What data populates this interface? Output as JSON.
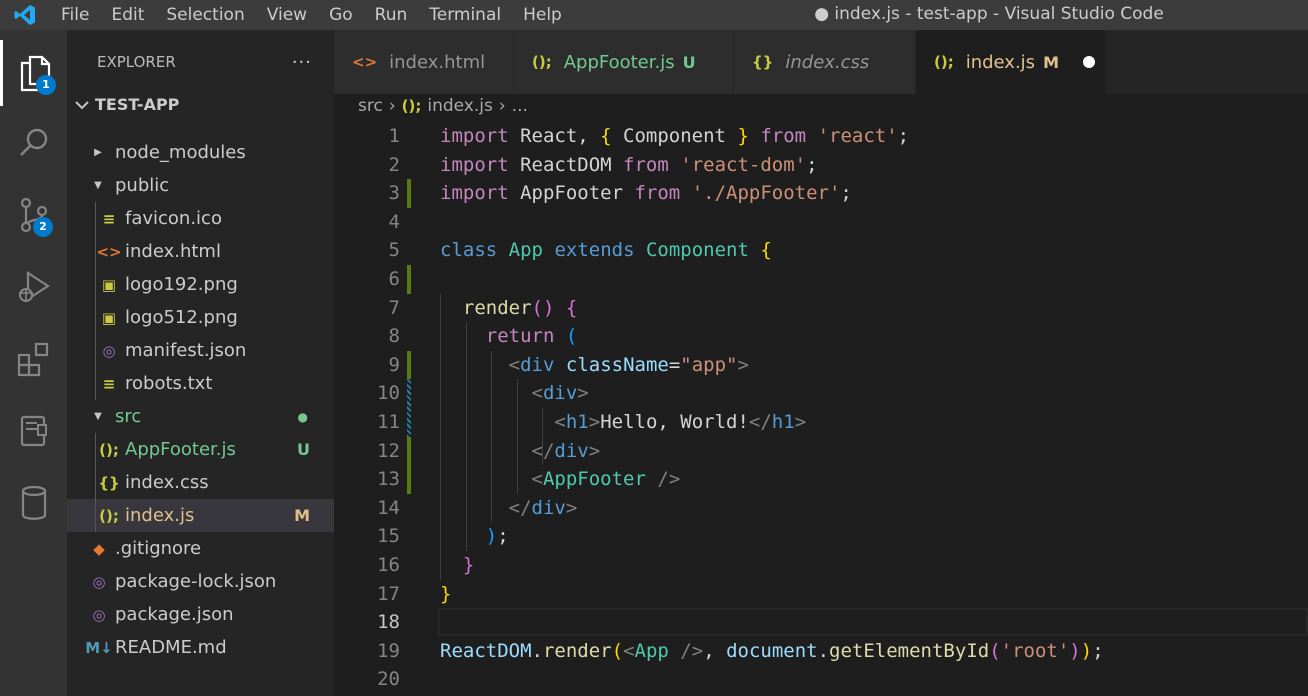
{
  "titlebar": {
    "menu": [
      "File",
      "Edit",
      "Selection",
      "View",
      "Go",
      "Run",
      "Terminal",
      "Help"
    ],
    "title": "● index.js - test-app - Visual Studio Code"
  },
  "activity": {
    "explorer_badge": "1",
    "scm_badge": "2"
  },
  "sidebar": {
    "title": "EXPLORER",
    "more": "···",
    "folder": "TEST-APP",
    "tree": [
      {
        "label": "node_modules",
        "type": "folder-collapsed",
        "depth": 0
      },
      {
        "label": "public",
        "type": "folder-open",
        "depth": 0
      },
      {
        "label": "favicon.ico",
        "icon": "≡",
        "iconColor": "#cbcb41",
        "depth": 1
      },
      {
        "label": "index.html",
        "icon": "<>",
        "iconColor": "#e37933",
        "depth": 1
      },
      {
        "label": "logo192.png",
        "icon": "▣",
        "iconColor": "#cbcb41",
        "depth": 1
      },
      {
        "label": "logo512.png",
        "icon": "▣",
        "iconColor": "#cbcb41",
        "depth": 1
      },
      {
        "label": "manifest.json",
        "icon": "◎",
        "iconColor": "#a074c4",
        "depth": 1
      },
      {
        "label": "robots.txt",
        "icon": "≡",
        "iconColor": "#cbcb41",
        "depth": 1
      },
      {
        "label": "src",
        "type": "folder-open",
        "depth": 0,
        "color": "#73c991",
        "status": "●",
        "statusColor": "#73c991"
      },
      {
        "label": "AppFooter.js",
        "icon": "();",
        "iconColor": "#cbcb41",
        "depth": 1,
        "color": "#73c991",
        "status": "U",
        "statusColor": "#73c991"
      },
      {
        "label": "index.css",
        "icon": "{}",
        "iconColor": "#cbcb41",
        "depth": 1
      },
      {
        "label": "index.js",
        "icon": "();",
        "iconColor": "#cbcb41",
        "depth": 1,
        "color": "#e2c08d",
        "status": "M",
        "statusColor": "#e2c08d",
        "selected": true
      },
      {
        "label": ".gitignore",
        "icon": "◆",
        "iconColor": "#e37933",
        "depth": 0
      },
      {
        "label": "package-lock.json",
        "icon": "◎",
        "iconColor": "#a074c4",
        "depth": 0
      },
      {
        "label": "package.json",
        "icon": "◎",
        "iconColor": "#a074c4",
        "depth": 0
      },
      {
        "label": "README.md",
        "icon": "M↓",
        "iconColor": "#519aba",
        "depth": 0
      }
    ]
  },
  "tabs": [
    {
      "label": "index.html",
      "icon": "<>",
      "iconColor": "#e37933"
    },
    {
      "label": "AppFooter.js",
      "icon": "();",
      "iconColor": "#cbcb41",
      "status": "U",
      "labelColor": "#73c991"
    },
    {
      "label": "index.css",
      "icon": "{}",
      "iconColor": "#cbcb41",
      "italic": true
    },
    {
      "label": "index.js",
      "icon": "();",
      "iconColor": "#cbcb41",
      "status": "M",
      "labelColor": "#e2c08d",
      "active": true
    }
  ],
  "breadcrumb": {
    "folder": "src",
    "file_icon": "();",
    "file": "index.js",
    "more": "..."
  },
  "editor": {
    "line_numbers": [
      "1",
      "2",
      "3",
      "4",
      "5",
      "6",
      "7",
      "8",
      "9",
      "10",
      "11",
      "12",
      "13",
      "14",
      "15",
      "16",
      "17",
      "18",
      "19",
      "20"
    ],
    "lines": [
      [
        [
          "kw2",
          "import"
        ],
        [
          "txt",
          " React, "
        ],
        [
          "br1",
          "{"
        ],
        [
          "txt",
          " Component "
        ],
        [
          "br1",
          "}"
        ],
        [
          "txt",
          " "
        ],
        [
          "kw2",
          "from"
        ],
        [
          "txt",
          " "
        ],
        [
          "str",
          "'react'"
        ],
        [
          "txt",
          ";"
        ]
      ],
      [
        [
          "kw2",
          "import"
        ],
        [
          "txt",
          " ReactDOM "
        ],
        [
          "kw2",
          "from"
        ],
        [
          "txt",
          " "
        ],
        [
          "str",
          "'react-dom'"
        ],
        [
          "txt",
          ";"
        ]
      ],
      [
        [
          "kw2",
          "import"
        ],
        [
          "txt",
          " AppFooter "
        ],
        [
          "kw2",
          "from"
        ],
        [
          "txt",
          " "
        ],
        [
          "str",
          "'./AppFooter'"
        ],
        [
          "txt",
          ";"
        ]
      ],
      [],
      [
        [
          "kw",
          "class"
        ],
        [
          "txt",
          " "
        ],
        [
          "cls",
          "App"
        ],
        [
          "txt",
          " "
        ],
        [
          "kw",
          "extends"
        ],
        [
          "txt",
          " "
        ],
        [
          "cls",
          "Component"
        ],
        [
          "txt",
          " "
        ],
        [
          "br1",
          "{"
        ]
      ],
      [],
      [
        [
          "txt",
          "  "
        ],
        [
          "fn",
          "render"
        ],
        [
          "br2",
          "()"
        ],
        [
          "txt",
          " "
        ],
        [
          "br2",
          "{"
        ]
      ],
      [
        [
          "txt",
          "    "
        ],
        [
          "kw2",
          "return"
        ],
        [
          "txt",
          " "
        ],
        [
          "br3",
          "("
        ]
      ],
      [
        [
          "txt",
          "      "
        ],
        [
          "tagp",
          "<"
        ],
        [
          "tag",
          "div"
        ],
        [
          "txt",
          " "
        ],
        [
          "attr",
          "className"
        ],
        [
          "txt",
          "="
        ],
        [
          "str",
          "\"app\""
        ],
        [
          "tagp",
          ">"
        ]
      ],
      [
        [
          "txt",
          "        "
        ],
        [
          "tagp",
          "<"
        ],
        [
          "tag",
          "div"
        ],
        [
          "tagp",
          ">"
        ]
      ],
      [
        [
          "txt",
          "          "
        ],
        [
          "tagp",
          "<"
        ],
        [
          "tag",
          "h1"
        ],
        [
          "tagp",
          ">"
        ],
        [
          "txt",
          "Hello, World!"
        ],
        [
          "tagp",
          "</"
        ],
        [
          "tag",
          "h1"
        ],
        [
          "tagp",
          ">"
        ]
      ],
      [
        [
          "txt",
          "        "
        ],
        [
          "tagp",
          "</"
        ],
        [
          "tag",
          "div"
        ],
        [
          "tagp",
          ">"
        ]
      ],
      [
        [
          "txt",
          "        "
        ],
        [
          "tagp",
          "<"
        ],
        [
          "cls",
          "AppFooter"
        ],
        [
          "txt",
          " "
        ],
        [
          "tagp",
          "/>"
        ]
      ],
      [
        [
          "txt",
          "      "
        ],
        [
          "tagp",
          "</"
        ],
        [
          "tag",
          "div"
        ],
        [
          "tagp",
          ">"
        ]
      ],
      [
        [
          "txt",
          "    "
        ],
        [
          "br3",
          ")"
        ],
        [
          "txt",
          ";"
        ]
      ],
      [
        [
          "txt",
          "  "
        ],
        [
          "br2",
          "}"
        ]
      ],
      [
        [
          "br1",
          "}"
        ]
      ],
      [],
      [
        [
          "var",
          "ReactDOM"
        ],
        [
          "txt",
          "."
        ],
        [
          "fn",
          "render"
        ],
        [
          "br1",
          "("
        ],
        [
          "tagp",
          "<"
        ],
        [
          "cls",
          "App"
        ],
        [
          "txt",
          " "
        ],
        [
          "tagp",
          "/>"
        ],
        [
          "txt",
          ", "
        ],
        [
          "var",
          "document"
        ],
        [
          "txt",
          "."
        ],
        [
          "fn",
          "getElementById"
        ],
        [
          "br2",
          "("
        ],
        [
          "str",
          "'root'"
        ],
        [
          "br2",
          ")"
        ],
        [
          "br1",
          ")"
        ],
        [
          "txt",
          ";"
        ]
      ],
      []
    ]
  },
  "colors": {
    "accent": "#007acc",
    "added": "#73c991",
    "modified": "#e2c08d",
    "gutter_added": "#587c0c",
    "gutter_modified": "#1b81a8"
  }
}
